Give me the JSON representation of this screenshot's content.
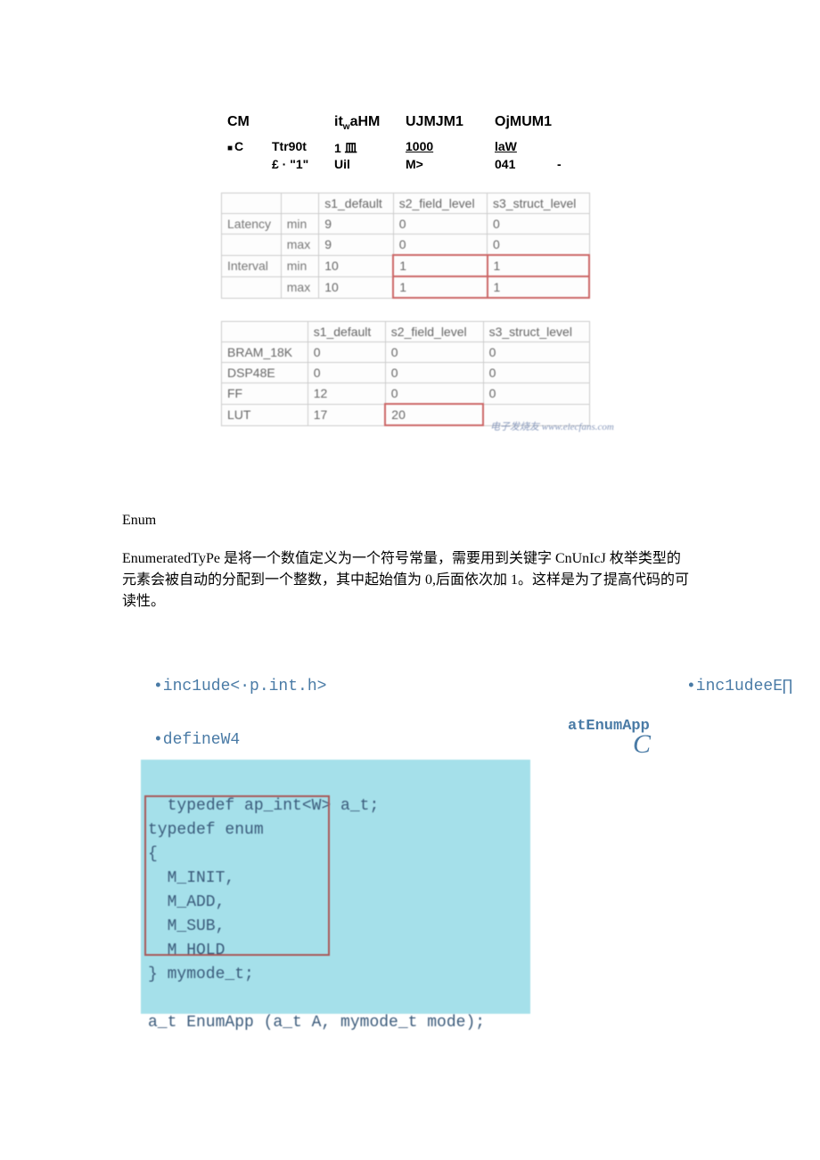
{
  "header": {
    "cm": "CM",
    "itw": "it",
    "itw_sub": "w",
    "itw_rest": "aHM",
    "uj": "UJMJM1",
    "oj": "OjMUM1",
    "c": "C",
    "ttr": "Ttr90t",
    "m1": "1 皿",
    "n1000": "1000",
    "law": "laW",
    "e1": "£ · \"1\"",
    "uil": "Uil",
    "mgt": "M>",
    "n041": "041",
    "dash": "-"
  },
  "table1": {
    "cols": [
      "",
      "",
      "s1_default",
      "s2_field_level",
      "s3_struct_level"
    ],
    "rows": [
      {
        "label": "Latency",
        "sub": "min",
        "c1": "9",
        "c2": "0",
        "c3": "0"
      },
      {
        "label": "",
        "sub": "max",
        "c1": "9",
        "c2": "0",
        "c3": "0"
      },
      {
        "label": "Interval",
        "sub": "min",
        "c1": "10",
        "c2": "1",
        "c3": "1"
      },
      {
        "label": "",
        "sub": "max",
        "c1": "10",
        "c2": "1",
        "c3": "1"
      }
    ]
  },
  "table2": {
    "cols": [
      "",
      "s1_default",
      "s2_field_level",
      "s3_struct_level"
    ],
    "rows": [
      {
        "label": "BRAM_18K",
        "c1": "0",
        "c2": "0",
        "c3": "0"
      },
      {
        "label": "DSP48E",
        "c1": "0",
        "c2": "0",
        "c3": "0"
      },
      {
        "label": "FF",
        "c1": "12",
        "c2": "0",
        "c3": "0"
      },
      {
        "label": "LUT",
        "c1": "17",
        "c2": "20",
        "c3": ""
      }
    ]
  },
  "watermark": "电子发烧友 www.elecfans.com",
  "enum": {
    "title": "Enum",
    "para": "EnumeratedTyPe 是将一个数值定义为一个符号常量，需要用到关键字 CnUnIcJ 枚举类型的元素会被自动的分配到一个整数，其中起始值为 0,后面依次加 1。这样是为了提高代码的可读性。"
  },
  "code": {
    "inc1": "•inc1ude<·p.int.h>",
    "inc2": "•inc1udeeE∏",
    "enumapp": "atEnumApp",
    "bigc": "C",
    "def": "•defineW4",
    "block": "typedef ap_int<W> a_t;\ntypedef enum\n{\n  M_INIT,\n  M_ADD,\n  M_SUB,\n  M_HOLD\n} mymode_t;\n\na_t EnumApp (a_t A, mymode_t mode);"
  }
}
